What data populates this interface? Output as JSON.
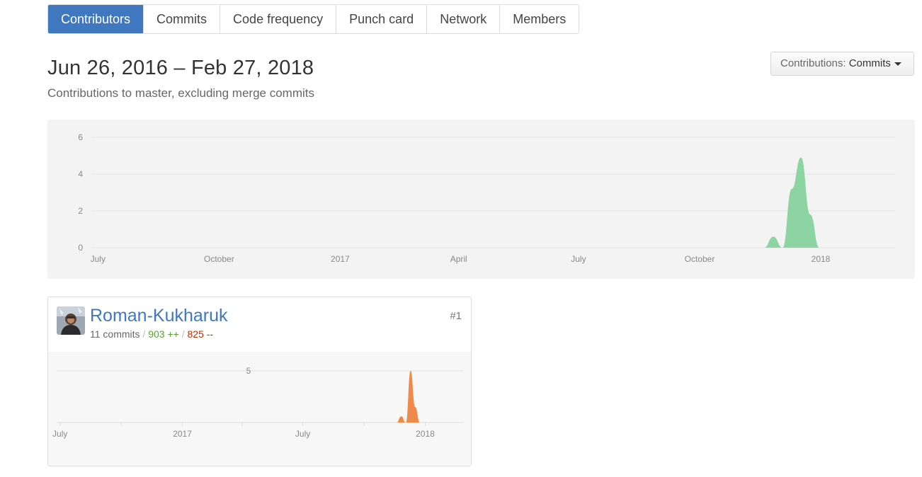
{
  "tabs": [
    {
      "label": "Contributors",
      "active": true
    },
    {
      "label": "Commits",
      "active": false
    },
    {
      "label": "Code frequency",
      "active": false
    },
    {
      "label": "Punch card",
      "active": false
    },
    {
      "label": "Network",
      "active": false
    },
    {
      "label": "Members",
      "active": false
    }
  ],
  "header": {
    "date_range": "Jun 26, 2016 – Feb 27, 2018",
    "subtitle": "Contributions to master, excluding merge commits"
  },
  "dropdown": {
    "label": "Contributions: ",
    "value": "Commits"
  },
  "colors": {
    "accent": "#4078c0",
    "main_area": "#8cd4a1",
    "contributor_area": "#f08a4b",
    "additions": "#55a532",
    "deletions": "#bd2c00"
  },
  "chart_data": [
    {
      "type": "area",
      "yticks": [
        "0",
        "2",
        "4",
        "6"
      ],
      "ylim": [
        0,
        6
      ],
      "xticks": [
        "July",
        "October",
        "2017",
        "April",
        "July",
        "October",
        "2018"
      ],
      "x": [
        "2017-11-19",
        "2017-11-26",
        "2017-12-03",
        "2017-12-10",
        "2017-12-17",
        "2017-12-24",
        "2017-12-31",
        "2018-01-07"
      ],
      "series": [
        {
          "values": [
            0,
            0.6,
            0,
            3.2,
            4.9,
            1.8,
            0,
            0
          ]
        }
      ],
      "grid": true
    },
    {
      "type": "area",
      "yticks": [
        "5"
      ],
      "xticks": [
        "July",
        "2017",
        "July",
        "2018"
      ],
      "x": [
        "2017-11-19",
        "2017-11-26",
        "2017-12-03",
        "2017-12-10",
        "2017-12-17",
        "2017-12-24",
        "2018-01-07"
      ],
      "series": [
        {
          "values": [
            0,
            0.6,
            0,
            5,
            1.5,
            0,
            0
          ]
        }
      ],
      "grid": true
    }
  ],
  "contributor": {
    "name": "Roman-Kukharuk",
    "commits": "11 commits",
    "separator": " / ",
    "additions": "903 ++",
    "deletions": "825 --",
    "rank": "#1"
  }
}
